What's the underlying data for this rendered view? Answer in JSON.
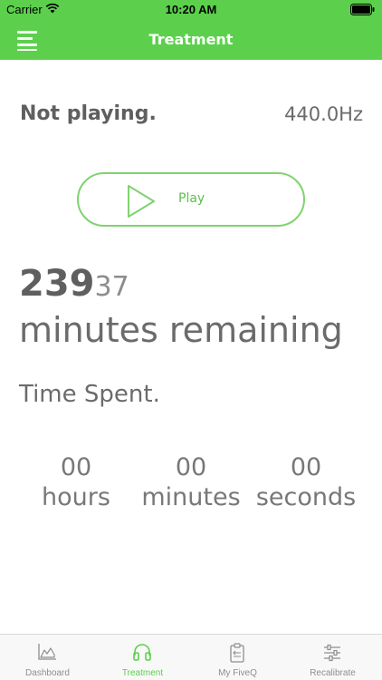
{
  "status_bar": {
    "carrier": "Carrier",
    "time": "10:20 AM",
    "wifi_icon": "wifi-icon",
    "battery_icon": "battery-icon"
  },
  "nav_bar": {
    "title": "Treatment",
    "menu_icon": "hamburger-menu-icon"
  },
  "player": {
    "status": "Not playing.",
    "frequency": "440.0Hz",
    "play_label": "Play",
    "play_icon": "play-icon"
  },
  "remaining": {
    "big_value": "239",
    "small_value": "37",
    "label": "minutes remaining"
  },
  "time_spent": {
    "label": "Time Spent.",
    "hours_value": "00",
    "hours_unit": "hours",
    "minutes_value": "00",
    "minutes_unit": "minutes",
    "seconds_value": "00",
    "seconds_unit": "seconds"
  },
  "tabs": [
    {
      "label": "Dashboard",
      "icon": "area-chart-icon",
      "active": false
    },
    {
      "label": "Treatment",
      "icon": "headphones-icon",
      "active": true
    },
    {
      "label": "My FiveQ",
      "icon": "clipboard-icon",
      "active": false
    },
    {
      "label": "Recalibrate",
      "icon": "sliders-icon",
      "active": false
    }
  ],
  "colors": {
    "accent": "#5cd04c",
    "play_border": "#7fd36f",
    "text_dark": "#5f5f5f",
    "tab_inactive": "#8e8e8e"
  }
}
